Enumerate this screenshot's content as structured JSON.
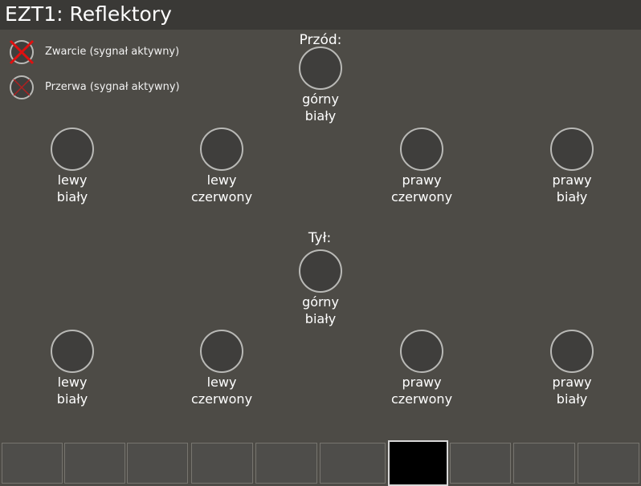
{
  "window": {
    "title": "EZT1: Reflektory"
  },
  "legend": [
    {
      "icon": "short-circuit-x-icon",
      "label": "Zwarcie (sygnał aktywny)",
      "color": "#e01010"
    },
    {
      "icon": "open-circuit-x-icon",
      "label": "Przerwa (sygnał aktywny)",
      "color": "#b02020"
    }
  ],
  "front": {
    "title": "Przód:",
    "lamps": {
      "top_white": {
        "line1": "górny",
        "line2": "biały"
      },
      "left_white": {
        "line1": "lewy",
        "line2": "biały"
      },
      "left_red": {
        "line1": "lewy",
        "line2": "czerwony"
      },
      "right_red": {
        "line1": "prawy",
        "line2": "czerwony"
      },
      "right_white": {
        "line1": "prawy",
        "line2": "biały"
      }
    }
  },
  "rear": {
    "title": "Tył:",
    "lamps": {
      "top_white": {
        "line1": "górny",
        "line2": "biały"
      },
      "left_white": {
        "line1": "lewy",
        "line2": "biały"
      },
      "left_red": {
        "line1": "lewy",
        "line2": "czerwony"
      },
      "right_red": {
        "line1": "prawy",
        "line2": "czerwony"
      },
      "right_white": {
        "line1": "prawy",
        "line2": "biały"
      }
    }
  },
  "bottom_tabs": {
    "count": 10,
    "active_index": 6
  }
}
